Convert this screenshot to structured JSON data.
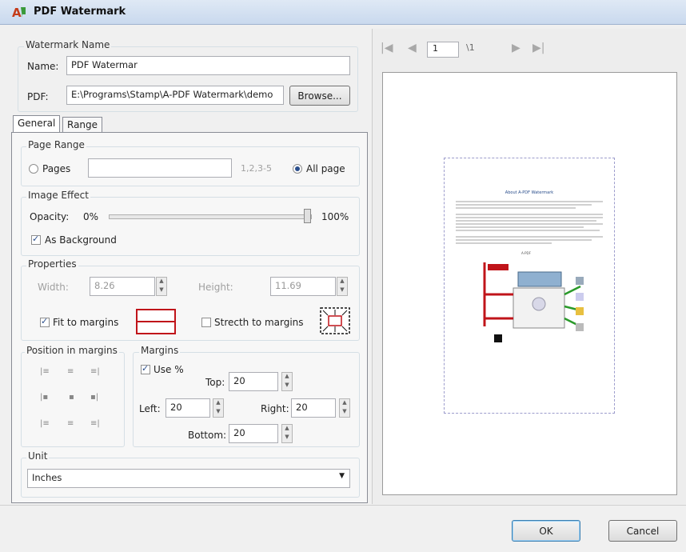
{
  "window": {
    "title": "PDF Watermark"
  },
  "watermark_name": {
    "group_label": "Watermark Name",
    "name_label": "Name:",
    "name_value": "PDF Watermar",
    "pdf_label": "PDF:",
    "pdf_value": "E:\\Programs\\Stamp\\A-PDF Watermark\\demo",
    "browse_label": "Browse..."
  },
  "tabs": [
    {
      "label": "General"
    },
    {
      "label": "Range"
    }
  ],
  "page_range": {
    "group_label": "Page Range",
    "pages_label": "Pages",
    "pages_value": "",
    "hint": "1,2,3-5",
    "all_label": "All page"
  },
  "image_effect": {
    "group_label": "Image Effect",
    "opacity_label": "Opacity:",
    "min_label": "0%",
    "max_label": "100%",
    "opacity_value": 1.0,
    "background_label": "As Background"
  },
  "properties": {
    "group_label": "Properties",
    "width_label": "Width:",
    "width_value": "8.26",
    "height_label": "Height:",
    "height_value": "11.69",
    "fit_label": "Fit to margins",
    "stretch_label": "Strecth to margins"
  },
  "position": {
    "group_label": "Position in margins"
  },
  "margins": {
    "group_label": "Margins",
    "use_pct_label": "Use %",
    "top_label": "Top:",
    "top_value": "20",
    "left_label": "Left:",
    "left_value": "20",
    "right_label": "Right:",
    "right_value": "20",
    "bottom_label": "Bottom:",
    "bottom_value": "20"
  },
  "unit": {
    "group_label": "Unit",
    "value": "Inches"
  },
  "preview": {
    "page_number": "1",
    "page_total": "\\1",
    "doc_title": "About A-PDF Watermark"
  },
  "footer": {
    "ok_label": "OK",
    "cancel_label": "Cancel"
  },
  "colors": {
    "accent": "#2a4e8c",
    "fit_icon": "#c0141a"
  }
}
